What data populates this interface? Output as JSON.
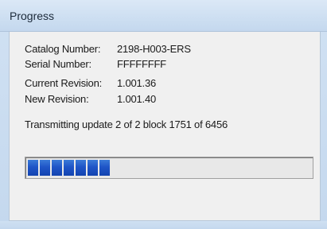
{
  "window": {
    "title": "Progress"
  },
  "details": {
    "catalog_label": "Catalog Number:",
    "catalog_value": "2198-H003-ERS",
    "serial_label": "Serial Number:",
    "serial_value": "FFFFFFFF",
    "current_revision_label": "Current Revision:",
    "current_revision_value": "1.001.36",
    "new_revision_label": "New Revision:",
    "new_revision_value": "1.001.40"
  },
  "status": {
    "text": "Transmitting update 2 of 2  block 1751 of 6456"
  },
  "progress": {
    "filled_blocks": 7,
    "accent_color": "#1f55c7"
  }
}
